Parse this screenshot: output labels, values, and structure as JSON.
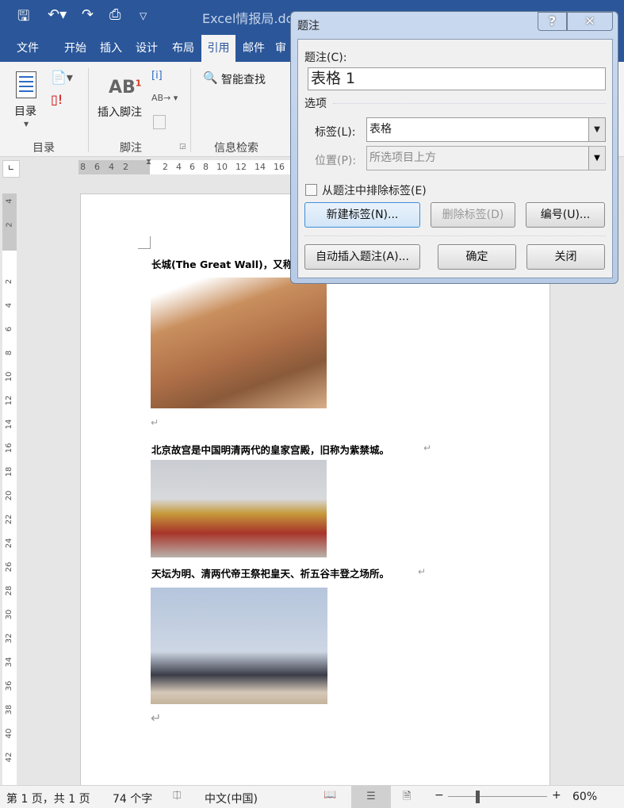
{
  "window": {
    "title": "Excel情报局.doc"
  },
  "tabs": [
    "文件",
    "开始",
    "插入",
    "设计",
    "布局",
    "引用",
    "邮件",
    "审"
  ],
  "ribbon": {
    "toc_label": "目录",
    "group_toc": "目录",
    "insert_footnote": "插入脚注",
    "footnote_super": "1",
    "group_footnote": "脚注",
    "smart_lookup": "智能查找",
    "group_research": "信息检索"
  },
  "ruler": {
    "left_ticks": [
      "8",
      "6",
      "4",
      "2"
    ],
    "right_ticks": [
      "2",
      "4",
      "6",
      "8",
      "10",
      "12",
      "14",
      "16"
    ],
    "vertical_ticks": [
      "4",
      "2",
      "2",
      "4",
      "6",
      "8",
      "10",
      "12",
      "14",
      "16",
      "18",
      "20",
      "22",
      "24",
      "26",
      "28",
      "30",
      "32",
      "34",
      "36",
      "38",
      "40",
      "42"
    ]
  },
  "document": {
    "p1": "长城(The Great Wall)，又称万",
    "p2": "北京故宫是中国明清两代的皇家宫殿，旧称为紫禁城。",
    "p3": "天坛为明、清两代帝王祭祀皇天、祈五谷丰登之场所。",
    "para_mark": "↵"
  },
  "dialog": {
    "title": "题注",
    "help": "?",
    "close": "✕",
    "caption_label": "题注(C):",
    "caption_value": "表格 1",
    "options_label": "选项",
    "label_label": "标签(L):",
    "label_value": "表格",
    "position_label": "位置(P):",
    "position_value": "所选项目上方",
    "exclude_label": "从题注中排除标签(E)",
    "exclude_checked": false,
    "new_label_btn": "新建标签(N)...",
    "delete_label_btn": "删除标签(D)",
    "numbering_btn": "编号(U)...",
    "autocaption_btn": "自动插入题注(A)...",
    "ok_btn": "确定",
    "close_btn": "关闭"
  },
  "status": {
    "page": "第 1 页，共 1 页",
    "words": "74 个字",
    "language": "中文(中国)",
    "zoom_minus": "−",
    "zoom_plus": "+",
    "zoom": "60%",
    "zoom_percent": 60
  },
  "colors": {
    "brand": "#2b579a"
  }
}
